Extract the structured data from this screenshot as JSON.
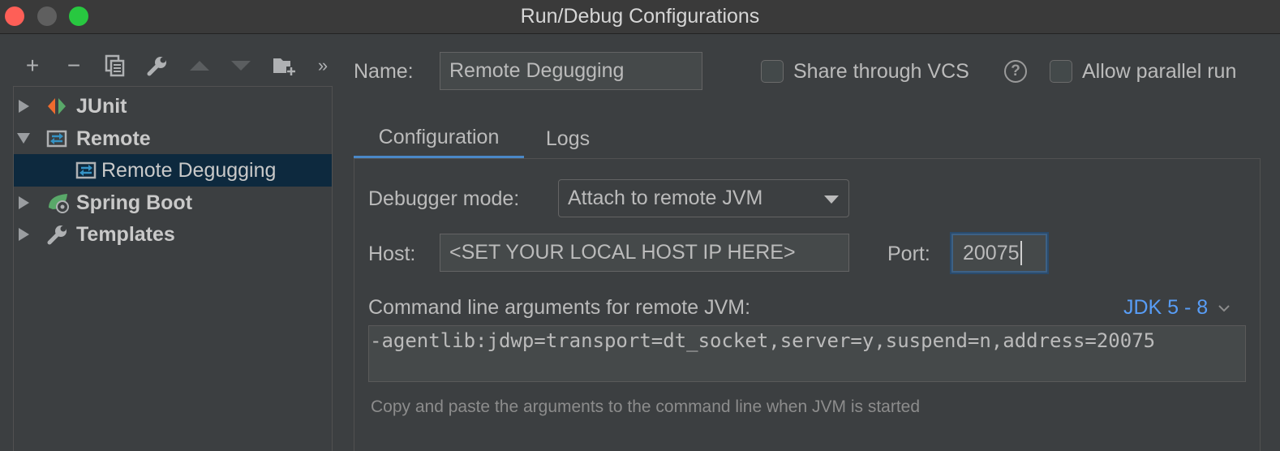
{
  "window": {
    "title": "Run/Debug Configurations"
  },
  "toolbar": {
    "add": "+",
    "remove": "−",
    "overflow": "»"
  },
  "tree": {
    "items": [
      {
        "label": "JUnit",
        "icon": "junit-icon",
        "expanded": false
      },
      {
        "label": "Remote",
        "icon": "remote-icon",
        "expanded": true
      },
      {
        "label": "Remote Degugging",
        "icon": "remote-icon",
        "selected": true
      },
      {
        "label": "Spring Boot",
        "icon": "spring-boot-icon",
        "expanded": false
      },
      {
        "label": "Templates",
        "icon": "wrench-icon",
        "expanded": false
      }
    ]
  },
  "header": {
    "name_label": "Name:",
    "name_value": "Remote Degugging",
    "share_vcs_label": "Share through VCS",
    "help": "?",
    "parallel_label": "Allow parallel run"
  },
  "tabs": [
    {
      "label": "Configuration",
      "active": true
    },
    {
      "label": "Logs",
      "active": false
    }
  ],
  "config": {
    "debugger_mode_label": "Debugger mode:",
    "debugger_mode_value": "Attach to remote JVM",
    "host_label": "Host:",
    "host_value": "<SET YOUR LOCAL HOST IP HERE>",
    "port_label": "Port:",
    "port_value": "20075",
    "cmd_label": "Command line arguments for remote JVM:",
    "jdk_label": "JDK 5 - 8",
    "cmd_value": "-agentlib:jdwp=transport=dt_socket,server=y,suspend=n,address=20075",
    "hint": "Copy and paste the arguments to the command line when JVM is started"
  },
  "colors": {
    "accent": "#4a88c7",
    "link": "#589df6",
    "selection": "#0d293e",
    "background": "#3c3f41"
  }
}
